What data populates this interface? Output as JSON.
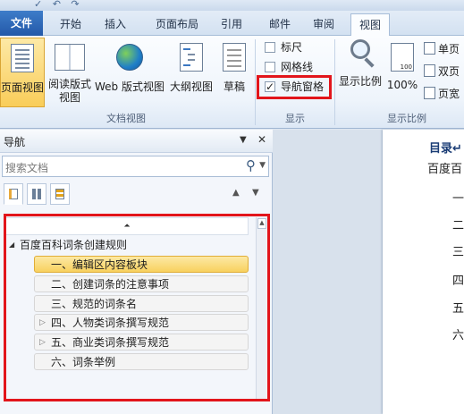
{
  "quick_access": "✓ ↶ ↷",
  "tabs": [
    {
      "label": "文件"
    },
    {
      "label": "开始"
    },
    {
      "label": "插入"
    },
    {
      "label": "页面布局"
    },
    {
      "label": "引用"
    },
    {
      "label": "邮件"
    },
    {
      "label": "审阅"
    },
    {
      "label": "视图"
    }
  ],
  "ribbon": {
    "doc_views": {
      "group_label": "文档视图",
      "print_layout": "页面视图",
      "reading_line1": "阅读版式",
      "reading_line2": "视图",
      "web_layout": "Web 版式视图",
      "outline": "大纲视图",
      "draft": "草稿"
    },
    "show": {
      "group_label": "显示",
      "ruler": "标尺",
      "gridlines": "网格线",
      "nav_pane": "导航窗格",
      "ruler_checked": false,
      "gridlines_checked": false,
      "nav_pane_checked": true
    },
    "zoom": {
      "group_label": "显示比例",
      "zoom": "显示比例",
      "hundred": "100%",
      "hundred_icon_text": "100",
      "one_page": "单页",
      "two_pages": "双页",
      "page_width": "页宽"
    }
  },
  "nav_pane": {
    "title": "导航",
    "menu_arrow": "▼",
    "close": "✕",
    "search_placeholder": "搜索文档",
    "search_icon": "⚲",
    "search_dropdown": "▼",
    "prev": "▲",
    "next": "▼",
    "collapse_glyph": "⏶",
    "root": "百度百科词条创建规则",
    "headings": [
      {
        "label": "一、编辑区内容板块",
        "expandable": false
      },
      {
        "label": "二、创建词条的注意事项",
        "expandable": false
      },
      {
        "label": "三、规范的词条名",
        "expandable": false
      },
      {
        "label": "四、人物类词条撰写规范",
        "expandable": true
      },
      {
        "label": "五、商业类词条撰写规范",
        "expandable": true
      },
      {
        "label": "六、词条举例",
        "expandable": false
      }
    ]
  },
  "document": {
    "toc_heading": "目录↵",
    "lines": [
      "百度百",
      "一",
      "二",
      "三",
      "四",
      "五",
      "六"
    ]
  },
  "colors": {
    "highlight_border": "#e2151b",
    "selected_fill": "#f9cd59",
    "file_tab": "#2459a8"
  }
}
